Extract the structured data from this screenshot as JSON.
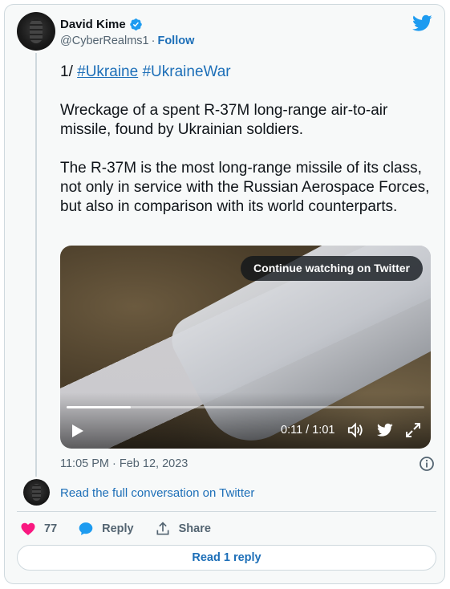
{
  "author": {
    "display_name": "David Kime",
    "handle": "@CyberRealms1",
    "separator": "·",
    "follow_label": "Follow"
  },
  "tweet": {
    "prefix": "1/",
    "hashtags": [
      "#Ukraine",
      "#UkraineWar"
    ],
    "paragraph_1": "Wreckage of a spent R-37M long-range air-to-air missile, found by Ukrainian soldiers.",
    "paragraph_2": "The R-37M is the most long-range missile of its class, not only in service with the Russian Aerospace Forces, but also in comparison with its world counterparts.",
    "timestamp": "11:05 PM · Feb 12, 2023"
  },
  "video": {
    "continue_label": "Continue watching on Twitter",
    "time_readout": "0:11 / 1:01",
    "progress_fraction": 0.18
  },
  "thread": {
    "read_full_label": "Read the full conversation on Twitter"
  },
  "actions": {
    "like_count": "77",
    "reply_label": "Reply",
    "share_label": "Share"
  },
  "footer": {
    "read_reply_label": "Read 1 reply"
  },
  "colors": {
    "link": "#1d6fb8",
    "brand": "#1d9bf0",
    "like": "#f91880",
    "muted": "#536471"
  },
  "icons": [
    "verified-badge-icon",
    "twitter-bird-icon",
    "play-icon",
    "volume-icon",
    "fullscreen-icon",
    "info-icon",
    "heart-icon",
    "reply-bubble-icon",
    "share-upload-icon"
  ]
}
